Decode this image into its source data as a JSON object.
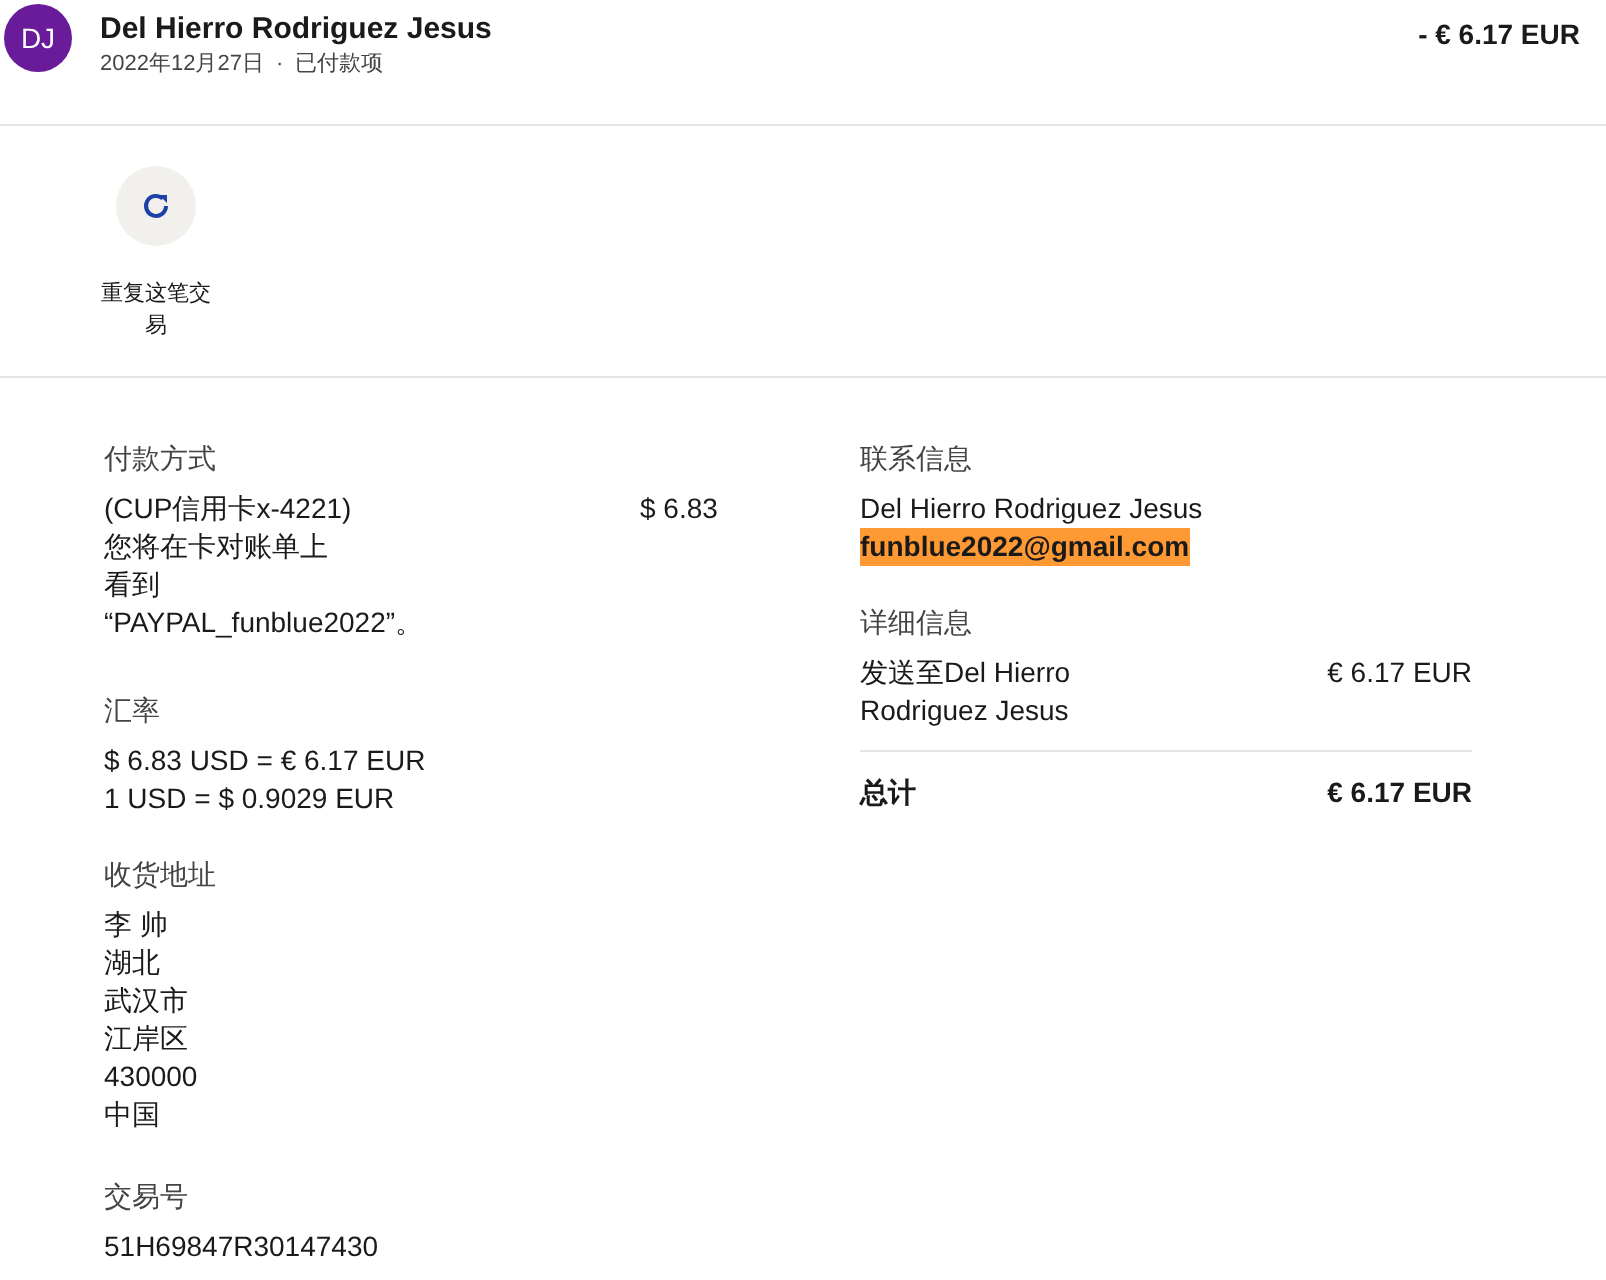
{
  "header": {
    "avatar": "DJ",
    "name": "Del Hierro Rodriguez Jesus",
    "date": "2022年12月27日",
    "separator": "·",
    "status": "已付款项",
    "amount": "- € 6.17 EUR"
  },
  "actions": [
    {
      "label_lines": [
        "重复这笔交",
        "易"
      ]
    }
  ],
  "payment": {
    "title": "付款方式",
    "card": "(CUP信用卡x-4221)",
    "amount": "$ 6.83",
    "note_lines": [
      "您将在卡对账单上",
      "看到",
      "“PAYPAL_funblue2022”。"
    ]
  },
  "exchange": {
    "title": "汇率",
    "lines": [
      "$ 6.83 USD = € 6.17 EUR",
      "1 USD = $ 0.9029 EUR"
    ]
  },
  "shipping": {
    "title": "收货地址",
    "lines": [
      "李 帅",
      "湖北",
      "武汉市",
      "江岸区",
      "430000",
      "中国"
    ]
  },
  "transaction": {
    "title": "交易号",
    "id": "51H69847R30147430"
  },
  "contact": {
    "title": "联系信息",
    "name": "Del Hierro Rodriguez Jesus",
    "email": "funblue2022@gmail.com",
    "email_highlighted": true
  },
  "details": {
    "title": "详细信息",
    "items": [
      {
        "label_lines": [
          "发送至Del Hierro",
          "Rodriguez Jesus"
        ],
        "amount": "€ 6.17 EUR"
      }
    ],
    "total_label": "总计",
    "total": "€ 6.17 EUR"
  }
}
